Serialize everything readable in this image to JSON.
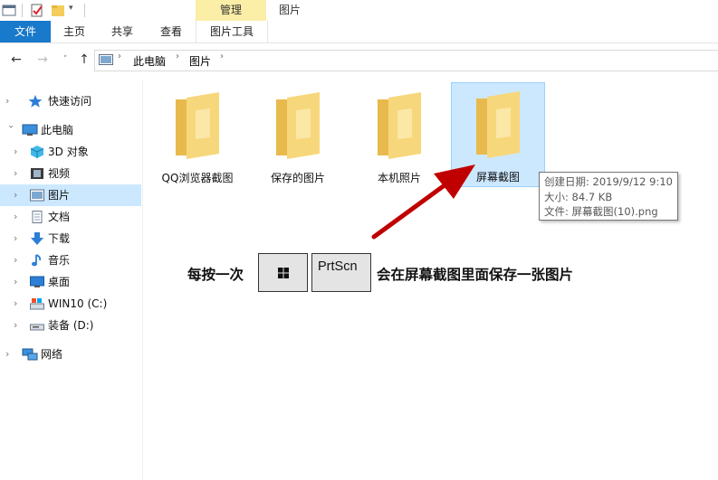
{
  "titlebar": {
    "context_tab_label": "管理",
    "window_title": "图片"
  },
  "ribbon": {
    "tabs": [
      {
        "label": "文件"
      },
      {
        "label": "主页"
      },
      {
        "label": "共享"
      },
      {
        "label": "查看"
      },
      {
        "label": "图片工具"
      }
    ]
  },
  "address": {
    "breadcrumb": [
      "此电脑",
      "图片"
    ]
  },
  "sidebar": {
    "items": [
      {
        "label": "快速访问",
        "icon": "star-icon"
      },
      {
        "label": "此电脑",
        "icon": "computer-icon"
      },
      {
        "label": "3D 对象",
        "icon": "cube-icon"
      },
      {
        "label": "视频",
        "icon": "video-icon"
      },
      {
        "label": "图片",
        "icon": "pictures-icon"
      },
      {
        "label": "文档",
        "icon": "document-icon"
      },
      {
        "label": "下载",
        "icon": "download-icon"
      },
      {
        "label": "音乐",
        "icon": "music-icon"
      },
      {
        "label": "桌面",
        "icon": "desktop-icon"
      },
      {
        "label": "WIN10 (C:)",
        "icon": "drive-c-icon"
      },
      {
        "label": "装备 (D:)",
        "icon": "drive-d-icon"
      },
      {
        "label": "网络",
        "icon": "network-icon"
      }
    ]
  },
  "folders": [
    {
      "label": "QQ浏览器截图"
    },
    {
      "label": "保存的图片"
    },
    {
      "label": "本机照片"
    },
    {
      "label": "屏幕截图"
    }
  ],
  "tooltip": {
    "created": "创建日期: 2019/9/12 9:10",
    "size": "大小: 84.7 KB",
    "files": "文件: 屏幕截图(10).png"
  },
  "instruction": {
    "prefix": "每按一次",
    "key2": "PrtScn",
    "suffix": "会在屏幕截图里面保存一张图片"
  },
  "colors": {
    "file_tab": "#1979ca",
    "context_tab": "#fbeea6",
    "selection": "#cce8ff",
    "arrow": "#c00000",
    "folder": "#f5d67a"
  }
}
